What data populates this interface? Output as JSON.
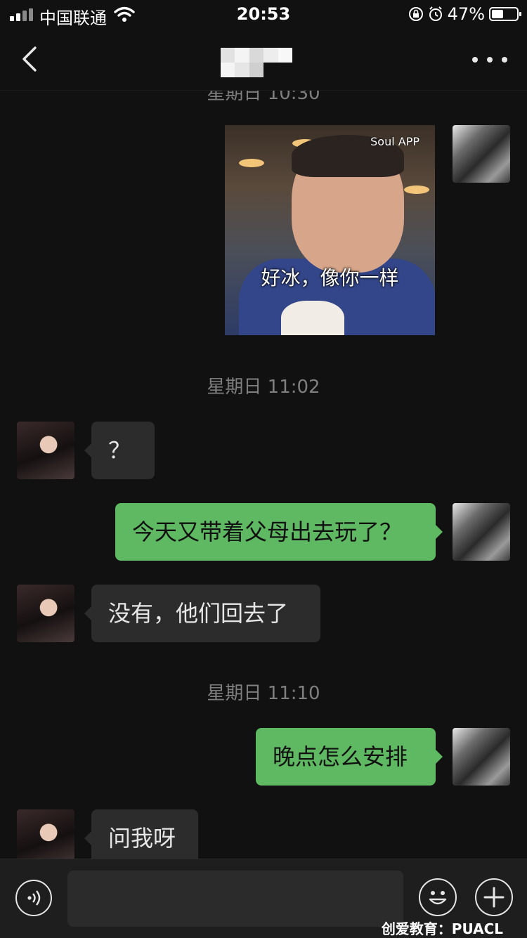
{
  "status_bar": {
    "carrier": "中国联通",
    "time": "20:53",
    "battery_percent": "47%",
    "battery_level": 0.47,
    "icons": [
      "signal-icon",
      "wifi-icon",
      "orientation-lock-icon",
      "alarm-icon",
      "battery-icon"
    ]
  },
  "nav": {
    "back_icon": "chevron-left-icon",
    "title": "",
    "more_icon": "more-dots-icon"
  },
  "chat": {
    "top_timestamp_partial": "星期日 10:30",
    "sticker": {
      "watermark": "Soul APP",
      "caption": "好冰，像你一样"
    },
    "timestamps": [
      "星期日 11:02",
      "星期日 11:10"
    ],
    "messages": [
      {
        "from": "them",
        "text": "？"
      },
      {
        "from": "me",
        "text": "今天又带着父母出去玩了？"
      },
      {
        "from": "them",
        "text": "没有，他们回去了"
      },
      {
        "from": "me",
        "text": "晚点怎么安排"
      },
      {
        "from": "them",
        "text": "问我呀"
      }
    ]
  },
  "input_bar": {
    "voice_icon": "voice-icon",
    "placeholder": "",
    "emoji_icon": "emoji-icon",
    "plus_icon": "plus-icon"
  },
  "watermark": "创爱教育：PUACL",
  "colors": {
    "background": "#111111",
    "bubble_me": "#5fb862",
    "bubble_them": "#2c2c2c",
    "timestamp": "#7f7f7f"
  }
}
